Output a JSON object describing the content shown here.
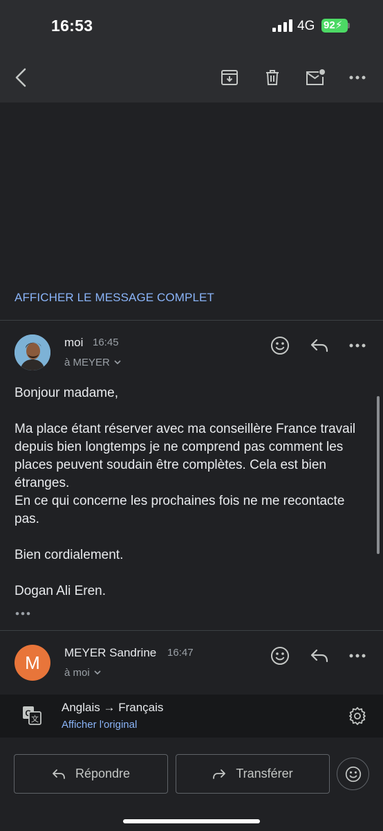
{
  "status_bar": {
    "time": "16:53",
    "network": "4G",
    "battery": "92"
  },
  "toolbar": {
    "back_icon": "arrow-back-icon",
    "archive_icon": "archive-icon",
    "delete_icon": "delete-icon",
    "mark_unread_icon": "mark-unread-icon",
    "more_icon": "more-horizontal-icon"
  },
  "show_full_message": "AFFICHER LE MESSAGE COMPLET",
  "message1": {
    "sender": "moi",
    "time": "16:45",
    "recipient": "à MEYER",
    "paragraphs": [
      "Bonjour madame,",
      "Ma place étant réserver avec ma conseillère France travail depuis bien longtemps je ne comprend pas comment les places peuvent soudain être complètes. Cela est bien étranges.",
      "En ce qui concerne les prochaines fois ne me recontacte pas.",
      "Bien cordialement.",
      "Dogan Ali Eren."
    ]
  },
  "message2": {
    "avatar_letter": "M",
    "sender": "MEYER Sandrine",
    "time": "16:47",
    "recipient": "à moi"
  },
  "translation": {
    "languages": "Anglais → Français",
    "show_original": "Afficher l'original"
  },
  "actions": {
    "reply": "Répondre",
    "forward": "Transférer"
  },
  "colors": {
    "accent_link": "#8ab4f8",
    "background": "#202124",
    "avatar_m": "#e8753a",
    "battery": "#4cd964"
  }
}
